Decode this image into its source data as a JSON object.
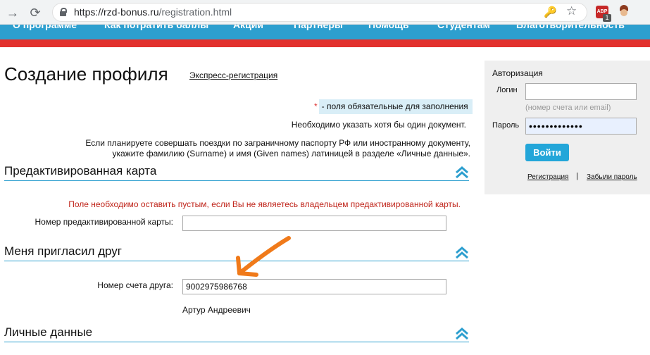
{
  "browser": {
    "url_host": "https://rzd-bonus.ru",
    "url_path": "/registration.html",
    "extension_badge": "1",
    "extension_abp": "ABP"
  },
  "site_nav": {
    "items": [
      "О программе",
      "Как потратить баллы",
      "Акции",
      "Партнеры",
      "Помощь",
      "Студентам",
      "Благотворительность"
    ]
  },
  "page": {
    "title": "Создание профиля",
    "express_link": "Экспресс-регистрация",
    "required_star": "*",
    "required_note": "- поля обязательные для заполнения",
    "doc_note": "Необходимо указать хотя бы один документ.",
    "latin_note_1": "Если планируете совершать поездки по заграничному паспорту РФ или иностранному документу,",
    "latin_note_2": "укажите фамилию (Surname) и имя (Given names) латиницей в разделе «Личные данные»."
  },
  "sections": {
    "prepaid": {
      "title": "Предактивированная карта",
      "warning": "Поле необходимо оставить пустым, если Вы не являетесь владельцем предактивированной карты.",
      "card_label": "Номер предактивированной карты:",
      "card_value": ""
    },
    "friend": {
      "title": "Меня пригласил друг",
      "account_label": "Номер счета друга:",
      "account_value": "9002975986768",
      "friend_name": "Артур Андреевич"
    },
    "personal": {
      "title": "Личные данные"
    }
  },
  "auth": {
    "title": "Авторизация",
    "login_label": "Логин",
    "login_value": "",
    "login_hint": "(номер счета или email)",
    "password_label": "Пароль",
    "password_value": "•••••••••••••",
    "login_button": "Войти",
    "register_link": "Регистрация",
    "separator": "|",
    "forgot_link": "Забыли пароль"
  },
  "colors": {
    "nav_blue": "#2d9fcf",
    "nav_red": "#e2312d",
    "button_blue": "#23a6d9",
    "warning_red": "#c0261c",
    "annotation_arrow": "#f07a1a"
  }
}
